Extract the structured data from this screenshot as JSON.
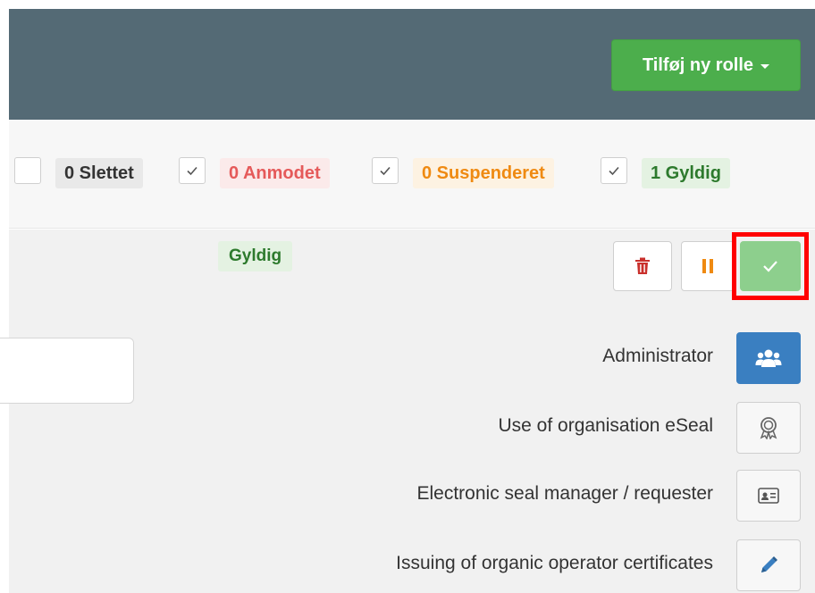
{
  "header": {
    "add_role_label": "Tilføj ny rolle"
  },
  "filters": [
    {
      "label": "0 Slettet",
      "checked": false
    },
    {
      "label": "0 Anmodet",
      "checked": true
    },
    {
      "label": "0 Suspenderet",
      "checked": true
    },
    {
      "label": "1 Gyldig",
      "checked": true
    }
  ],
  "role": {
    "status": "Gyldig",
    "actions": [
      "trash-icon",
      "pause-icon",
      "check-icon"
    ]
  },
  "permissions": [
    {
      "label": "Administrator",
      "icon": "users-icon",
      "active": true
    },
    {
      "label": "Use of organisation eSeal",
      "icon": "award-icon",
      "active": false
    },
    {
      "label": "Electronic seal manager / requester",
      "icon": "id-card-icon",
      "active": false
    },
    {
      "label": "Issuing of organic operator certificates",
      "icon": "pencil-icon",
      "active": false
    }
  ],
  "colors": {
    "header_bg": "#546a75",
    "success": "#4cae4c",
    "danger": "#c9302c",
    "warning": "#ef8a12",
    "primary": "#3a7fc1",
    "highlight": "#ff0000"
  }
}
